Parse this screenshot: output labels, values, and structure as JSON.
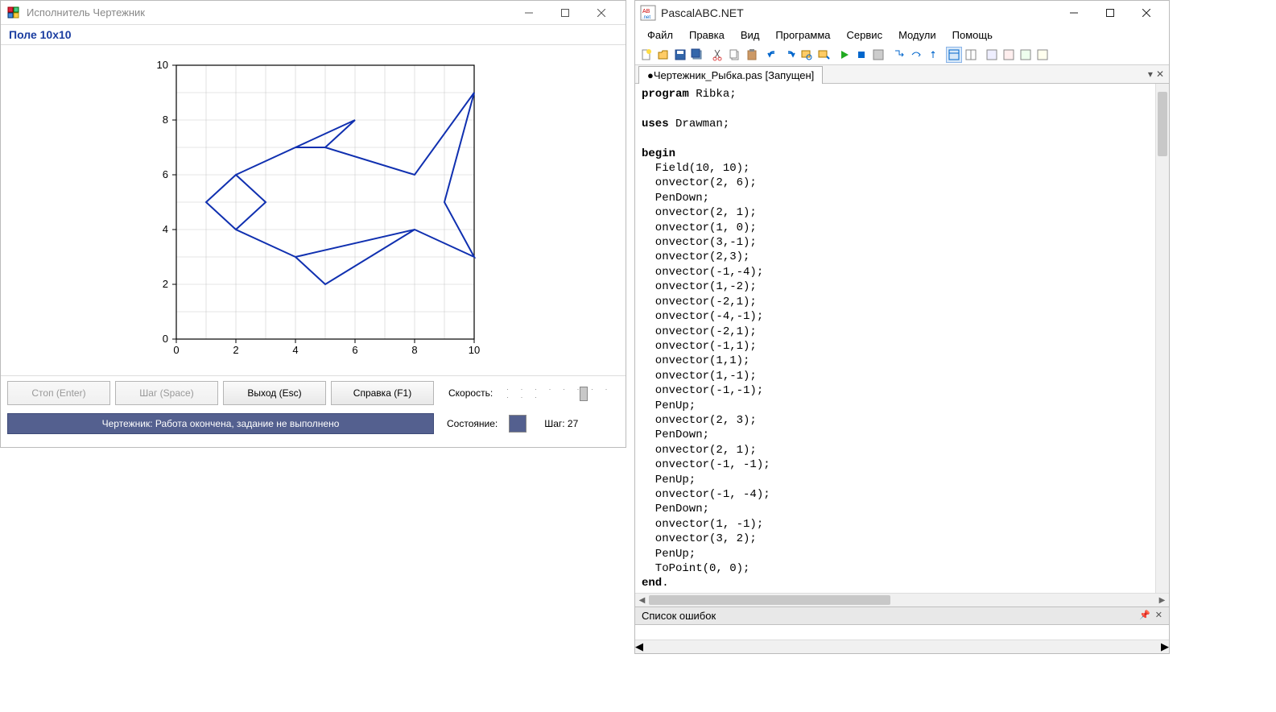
{
  "left": {
    "title": "Исполнитель Чертежник",
    "field_label": "Поле  10x10",
    "buttons": {
      "stop": "Стоп (Enter)",
      "step": "Шаг (Space)",
      "exit": "Выход (Esc)",
      "help": "Справка (F1)"
    },
    "speed_label": "Скорость:",
    "status_text": "Чертежник: Работа окончена, задание не выполнено",
    "state_label": "Состояние:",
    "step_label": "Шаг: 27"
  },
  "right": {
    "title": "PascalABC.NET",
    "menu": [
      "Файл",
      "Правка",
      "Вид",
      "Программа",
      "Сервис",
      "Модули",
      "Помощь"
    ],
    "tab": "●Чертежник_Рыбка.pas [Запущен]",
    "errors_title": "Список ошибок",
    "code_lines": [
      {
        "t": "program Ribka;",
        "kw": "program"
      },
      {
        "t": ""
      },
      {
        "t": "uses Drawman;",
        "kw": "uses"
      },
      {
        "t": ""
      },
      {
        "t": "begin",
        "kw": "begin"
      },
      {
        "t": "  Field(10, 10);"
      },
      {
        "t": "  onvector(2, 6);"
      },
      {
        "t": "  PenDown;"
      },
      {
        "t": "  onvector(2, 1);"
      },
      {
        "t": "  onvector(1, 0);"
      },
      {
        "t": "  onvector(3,-1);"
      },
      {
        "t": "  onvector(2,3);"
      },
      {
        "t": "  onvector(-1,-4);"
      },
      {
        "t": "  onvector(1,-2);"
      },
      {
        "t": "  onvector(-2,1);"
      },
      {
        "t": "  onvector(-4,-1);"
      },
      {
        "t": "  onvector(-2,1);"
      },
      {
        "t": "  onvector(-1,1);"
      },
      {
        "t": "  onvector(1,1);"
      },
      {
        "t": "  onvector(1,-1);"
      },
      {
        "t": "  onvector(-1,-1);"
      },
      {
        "t": "  PenUp;"
      },
      {
        "t": "  onvector(2, 3);"
      },
      {
        "t": "  PenDown;"
      },
      {
        "t": "  onvector(2, 1);"
      },
      {
        "t": "  onvector(-1, -1);"
      },
      {
        "t": "  PenUp;"
      },
      {
        "t": "  onvector(-1, -4);"
      },
      {
        "t": "  PenDown;"
      },
      {
        "t": "  onvector(1, -1);"
      },
      {
        "t": "  onvector(3, 2);"
      },
      {
        "t": "  PenUp;"
      },
      {
        "t": "  ToPoint(0, 0);"
      },
      {
        "t": "end.",
        "kw": "end"
      }
    ]
  },
  "chart_data": {
    "type": "line",
    "title": "",
    "xlabel": "",
    "ylabel": "",
    "xlim": [
      0,
      10
    ],
    "ylim": [
      0,
      10
    ],
    "xticks": [
      0,
      2,
      4,
      6,
      8,
      10
    ],
    "yticks": [
      0,
      2,
      4,
      6,
      8,
      10
    ],
    "segments": [
      [
        [
          2,
          6
        ],
        [
          4,
          7
        ],
        [
          5,
          7
        ],
        [
          8,
          6
        ],
        [
          10,
          9
        ],
        [
          9,
          5
        ],
        [
          10,
          3
        ],
        [
          8,
          4
        ],
        [
          4,
          3
        ],
        [
          2,
          4
        ],
        [
          1,
          5
        ],
        [
          2,
          6
        ],
        [
          3,
          5
        ],
        [
          2,
          4
        ]
      ],
      [
        [
          4,
          7
        ],
        [
          6,
          8
        ],
        [
          5,
          7
        ]
      ],
      [
        [
          4,
          3
        ],
        [
          5,
          2
        ],
        [
          8,
          4
        ]
      ]
    ]
  }
}
